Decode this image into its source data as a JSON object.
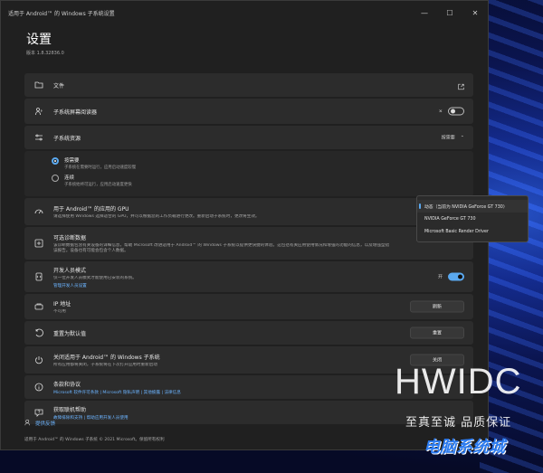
{
  "window": {
    "title": "适用于 Android™ 的 Windows 子系统设置"
  },
  "header": {
    "title": "设置",
    "version": "版本 1.8.32836.0"
  },
  "rows": {
    "files": {
      "label": "文件"
    },
    "screen_reader": {
      "label": "子系统屏幕阅读器",
      "toggle_state": "off"
    },
    "resources": {
      "label": "子系统资源",
      "value": "按需要"
    },
    "radio_needed": {
      "label": "按需要",
      "sub": "子系统在需要时运行，应用启动速度较慢"
    },
    "radio_continuous": {
      "label": "连续",
      "sub": "子系统始终可运行，应用启动速度更快"
    },
    "gpu": {
      "label": "用于 Android™ 的应用的 GPU",
      "sub": "请选择使用 Windows 选择适合的 GPU，并可以根据您的工作负载进行更改。重新启动子系统时，更改将生效。"
    },
    "diagnostics": {
      "label": "可选诊断数据",
      "sub": "该诊断数据包含有关设备的详细信息，帮助 Microsoft 改进适用于 Android™ 的 Windows 子系统以提供更快捷的体验。这包括有关应用使用情况和增强的功能的信息，以及增强型错误报告。设备也有可能会包含个人数据。"
    },
    "dev_mode": {
      "label": "开发人员模式",
      "sub": "仅一位开发人员模式才能使用已安装的系统。",
      "link": "管理开发人员设置",
      "toggle_label": "开",
      "toggle_state": "on"
    },
    "ip": {
      "label": "IP 地址",
      "sub": "不可用",
      "button": "刷新"
    },
    "reset": {
      "label": "重置为默认值",
      "button": "重置"
    },
    "shutdown": {
      "label": "关闭适用于 Android™ 的 Windows 子系统",
      "sub": "所有应用都将关闭，子系统将在下次打开应用时重新启动",
      "button": "关闭"
    },
    "terms": {
      "label": "条款和协议",
      "links": "Microsoft 软件许可条款 | Microsoft 隐私声明 | 其他披露 | 法律信息"
    },
    "help": {
      "label": "获取联机帮助",
      "links": "故障排除和支持 | 帮助应用开发人员使用"
    }
  },
  "gpu_dropdown": {
    "options": [
      "动态（当前为 NVIDIA GeForce GT 730）",
      "NVIDIA GeForce GT 730",
      "Microsoft Basic Render Driver"
    ],
    "selected_index": 0
  },
  "footer": {
    "feedback": "提供反馈",
    "copyright": "适用于 Android™ 的 Windows 子系统 © 2021 Microsoft。保留所有权利"
  },
  "watermark": {
    "brand": "HWIDC",
    "tagline": "至真至诚 品质保证",
    "logo": "电脑系统城"
  },
  "colors": {
    "accent": "#5aa9f0",
    "background": "#202020",
    "row": "#2c2c2c",
    "link": "#6cb4ff"
  }
}
